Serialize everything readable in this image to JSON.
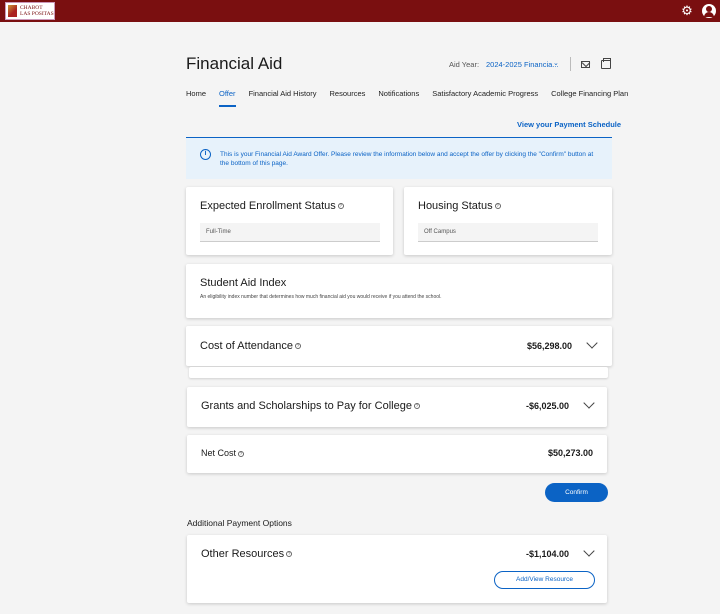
{
  "header": {
    "logo_line1": "CHABOT",
    "logo_line2": "LAS POSITAS",
    "settings_icon": "gear-icon",
    "user_icon": "user-icon",
    "brand_color": "#7a0f10"
  },
  "page": {
    "title": "Financial Aid",
    "aid_year_label": "Aid Year:",
    "aid_year_value": "2024-2025 Financia...",
    "accent_color": "#0b63c5"
  },
  "tabs": [
    {
      "label": "Home"
    },
    {
      "label": "Offer"
    },
    {
      "label": "Financial Aid History"
    },
    {
      "label": "Resources"
    },
    {
      "label": "Notifications"
    },
    {
      "label": "Satisfactory Academic Progress"
    },
    {
      "label": "College Financing Plan"
    }
  ],
  "active_tab": "Offer",
  "payment_schedule_link": "View your Payment Schedule",
  "info_banner": {
    "icon": "info-icon",
    "text": "This is your Financial Aid Award Offer. Please review the information below and accept the offer by clicking the \"Confirm\" button at the bottom of this page."
  },
  "enrollment": {
    "title": "Expected Enrollment Status",
    "value": "Full-Time"
  },
  "housing": {
    "title": "Housing Status",
    "value": "Off Campus"
  },
  "sai": {
    "title": "Student Aid Index",
    "description": "An eligibility index number that determines how much financial aid you would receive if you attend the school."
  },
  "cost_of_attendance": {
    "title": "Cost of Attendance",
    "amount": "$56,298.00"
  },
  "grants": {
    "title": "Grants and Scholarships to Pay for College",
    "amount": "-$6,025.00"
  },
  "net_cost": {
    "title": "Net Cost",
    "amount": "$50,273.00"
  },
  "confirm_button": "Confirm",
  "additional_payment_label": "Additional Payment Options",
  "other_resources": {
    "title": "Other Resources",
    "amount": "-$1,104.00",
    "button": "Add/View Resource"
  }
}
